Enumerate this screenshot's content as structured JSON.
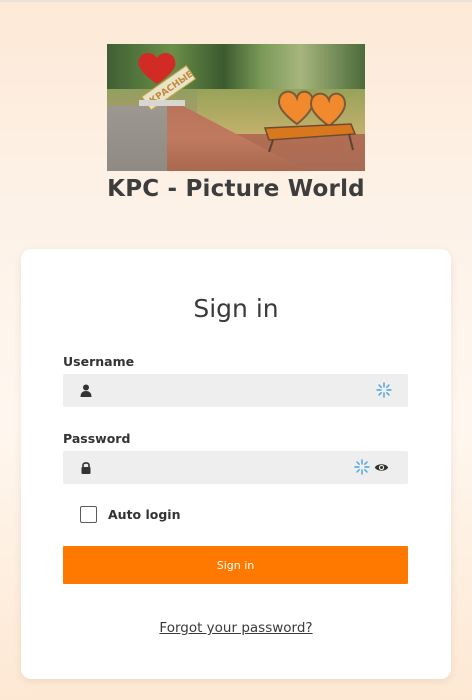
{
  "brand": {
    "logo_title": "KPC - Picture World",
    "sign_text": "КРАСНЫЕ"
  },
  "form": {
    "heading": "Sign in",
    "username": {
      "label": "Username",
      "value": "",
      "icon": "user-icon",
      "helper_icon": "spark-icon"
    },
    "password": {
      "label": "Password",
      "value": "",
      "icon": "lock-icon",
      "helper_icon": "spark-icon",
      "toggle_icon": "eye-icon"
    },
    "auto_login": {
      "label": "Auto login",
      "checked": false
    },
    "submit_label": "Sign in",
    "forgot_label": "Forgot your password?"
  },
  "colors": {
    "accent": "#ff7900",
    "spark": "#4aa3df",
    "text": "#3a3a3a"
  }
}
